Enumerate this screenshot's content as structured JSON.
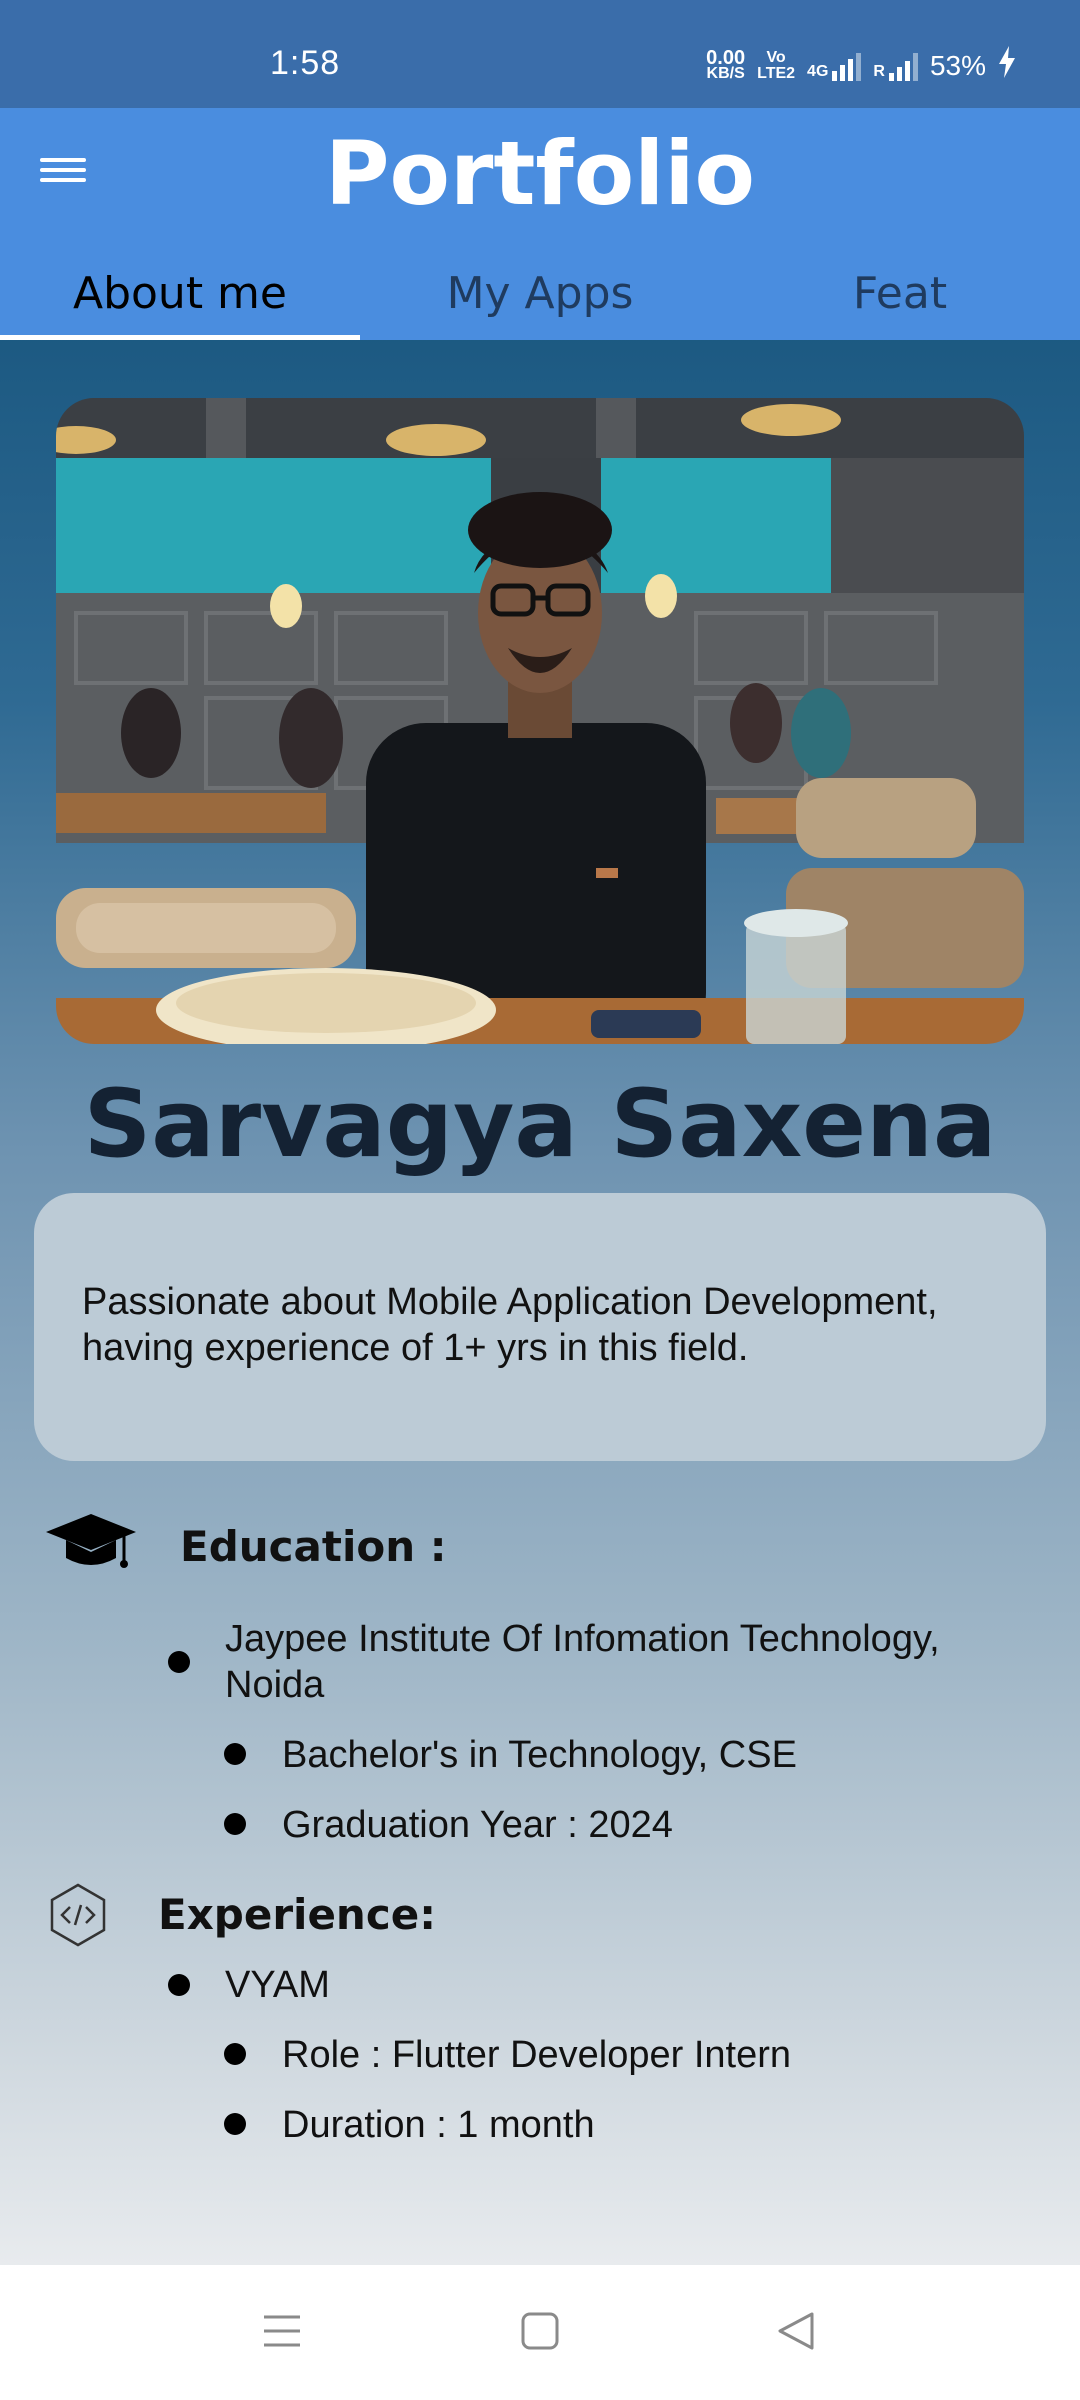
{
  "status_bar": {
    "time": "1:58",
    "speed_value": "0.00",
    "speed_unit": "KB/S",
    "volte_top": "Vo",
    "volte_bottom": "LTE2",
    "network": "4G",
    "roaming": "R",
    "battery": "53%"
  },
  "app_bar": {
    "title": "Portfolio",
    "tabs": [
      {
        "label": "About me",
        "active": true
      },
      {
        "label": "My Apps",
        "active": false
      },
      {
        "label": "Feat",
        "active": false
      }
    ],
    "color": "#4a8ddf"
  },
  "profile": {
    "name": "Sarvagya Saxena",
    "bio": "Passionate about Mobile Application Development, having experience of 1+ yrs in this field."
  },
  "education": {
    "heading": "Education :",
    "icon": "graduation-cap-icon",
    "institution": "Jaypee Institute Of Infomation Technology, Noida",
    "details": [
      "Bachelor's in Technology, CSE",
      "Graduation Year : 2024"
    ]
  },
  "experience": {
    "heading": "Experience:",
    "icon": "code-icon",
    "company": "VYAM",
    "details": [
      "Role : Flutter Developer Intern",
      "Duration : 1 month"
    ]
  },
  "nav_bar": {
    "icons": [
      "menu-icon",
      "home-icon",
      "back-icon"
    ]
  }
}
